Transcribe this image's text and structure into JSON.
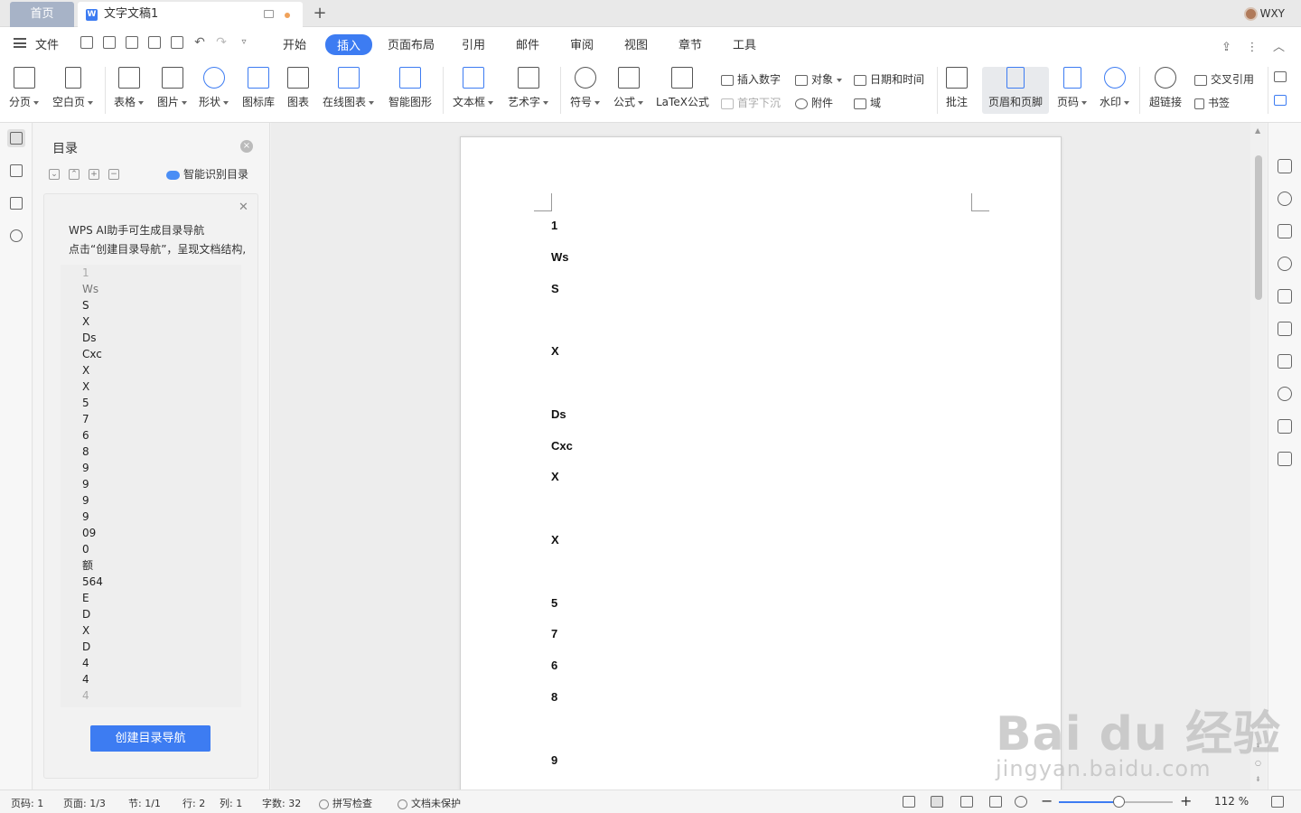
{
  "titlebar": {
    "home_tab": "首页",
    "doc_tab": "文字文稿1",
    "add_tab": "+",
    "user_name": "WXY"
  },
  "menubar": {
    "file_label": "文件",
    "items": [
      "开始",
      "插入",
      "页面布局",
      "引用",
      "邮件",
      "审阅",
      "视图",
      "章节",
      "工具"
    ],
    "active_index": 1
  },
  "ribbon": {
    "page_break": "分页",
    "blank_page": "空白页",
    "table": "表格",
    "picture": "图片",
    "shape": "形状",
    "icon_lib": "图标库",
    "chart": "图表",
    "online_chart": "在线图表",
    "smart_graphic": "智能图形",
    "textbox": "文本框",
    "wordart": "艺术字",
    "symbol": "符号",
    "formula": "公式",
    "latex": "LaTeX公式",
    "insert_number": "插入数字",
    "drop_cap": "首字下沉",
    "object": "对象",
    "attachment": "附件",
    "date_time": "日期和时间",
    "field": "域",
    "comment": "批注",
    "header_footer": "页眉和页脚",
    "page_number": "页码",
    "watermark": "水印",
    "hyperlink": "超链接",
    "cross_ref": "交叉引用",
    "bookmark": "书签"
  },
  "nav": {
    "title": "目录",
    "smart_toc": "智能识别目录",
    "ai_line1": "WPS AI助手可生成目录导航",
    "ai_line2": "点击“创建目录导航”，呈现文档结构,",
    "ai_list": [
      "1",
      "Ws",
      "S",
      "X",
      "Ds",
      "Cxc",
      "X",
      "X",
      "5",
      "7",
      "6",
      "8",
      "9",
      "9",
      "9",
      "9",
      "09",
      "0",
      "额",
      "564",
      "E",
      "D",
      "X",
      "D",
      "4",
      "4",
      "4"
    ],
    "create_button": "创建目录导航"
  },
  "document": {
    "lines": [
      "1",
      "Ws",
      "S",
      "",
      "X",
      "",
      "Ds",
      "Cxc",
      "X",
      "",
      "X",
      "",
      "5",
      "7",
      "6",
      "8",
      "",
      "9"
    ]
  },
  "statusbar": {
    "page_code": "页码: 1",
    "page": "页面: 1/3",
    "section": "节: 1/1",
    "row": "行: 2",
    "col": "列: 1",
    "word_count": "字数: 32",
    "spell_check": "拼写检查",
    "protect": "文档未保护",
    "zoom": "112 %",
    "zoom_level": 0.52
  },
  "watermark": {
    "brand": "Bai du 经验",
    "url": "jingyan.baidu.com"
  }
}
